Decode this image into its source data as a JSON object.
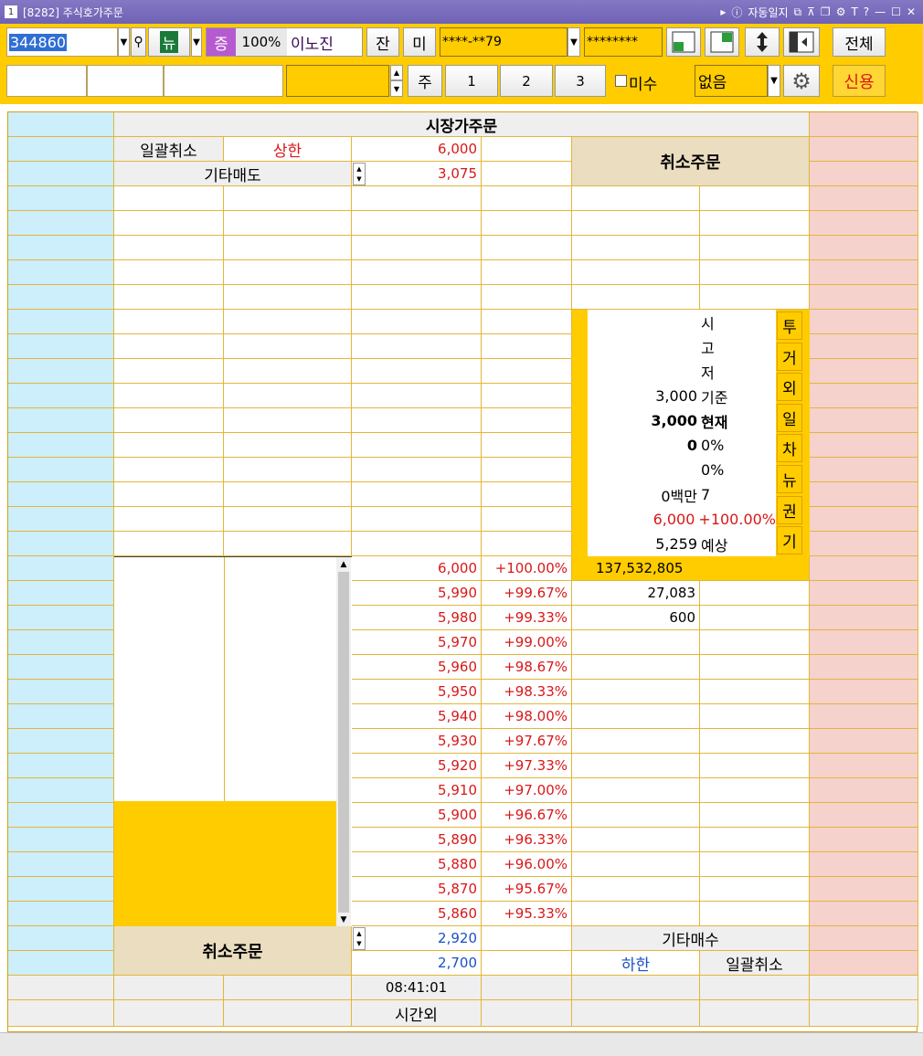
{
  "window": {
    "number": "1",
    "title": "[8282] 주식호가주문",
    "auto_log": "자동일지"
  },
  "toolbar": {
    "stock_code": "344860",
    "news_label": "뉴",
    "margin_badge": "증",
    "margin_rate": "100%",
    "stock_name": "이노진",
    "balance_label": "잔",
    "unfilled_label": "미",
    "account": "****-**79",
    "password": "********",
    "all_label": "전체",
    "qty_unit": "주",
    "qty_presets": [
      "1",
      "2",
      "3"
    ],
    "misu_label": "미수",
    "credit_select": "없음",
    "credit_label": "신용"
  },
  "orderbook": {
    "header_title": "시장가주문",
    "bulk_cancel_top": "일괄취소",
    "upper_limit_label": "상한",
    "upper_limit_price": "6,000",
    "other_sell_label": "기타매도",
    "other_sell_price": "3,075",
    "cancel_order_top": "취소주문",
    "info_labels": [
      "시",
      "고",
      "저",
      "기준",
      "현재"
    ],
    "base_price": "3,000",
    "current_price": "3,000",
    "change": "0",
    "change_pct": "0%",
    "change_pct2": "0%",
    "volume_amount": "0백만",
    "volume_count": "7",
    "expected_high": "6,000",
    "expected_high_pct": "+100.00%",
    "expected_price": "5,259",
    "expected_label": "예상",
    "side_buttons": [
      "투",
      "거",
      "외",
      "일",
      "차",
      "뉴",
      "권",
      "기"
    ],
    "bid_rows": [
      {
        "price": "6,000",
        "pct": "+100.00%",
        "qty": "137,532,805"
      },
      {
        "price": "5,990",
        "pct": "+99.67%",
        "qty": "27,083"
      },
      {
        "price": "5,980",
        "pct": "+99.33%",
        "qty": "600"
      },
      {
        "price": "5,970",
        "pct": "+99.00%",
        "qty": ""
      },
      {
        "price": "5,960",
        "pct": "+98.67%",
        "qty": ""
      },
      {
        "price": "5,950",
        "pct": "+98.33%",
        "qty": ""
      },
      {
        "price": "5,940",
        "pct": "+98.00%",
        "qty": ""
      },
      {
        "price": "5,930",
        "pct": "+97.67%",
        "qty": ""
      },
      {
        "price": "5,920",
        "pct": "+97.33%",
        "qty": ""
      },
      {
        "price": "5,910",
        "pct": "+97.00%",
        "qty": ""
      },
      {
        "price": "5,900",
        "pct": "+96.67%",
        "qty": ""
      },
      {
        "price": "5,890",
        "pct": "+96.33%",
        "qty": ""
      },
      {
        "price": "5,880",
        "pct": "+96.00%",
        "qty": ""
      },
      {
        "price": "5,870",
        "pct": "+95.67%",
        "qty": ""
      },
      {
        "price": "5,860",
        "pct": "+95.33%",
        "qty": ""
      }
    ],
    "cancel_order_bottom": "취소주문",
    "other_buy_price": "2,920",
    "other_buy_label": "기타매수",
    "lower_limit_price": "2,700",
    "lower_limit_label": "하한",
    "bulk_cancel_bottom": "일괄취소",
    "time": "08:41:01",
    "after_hours_label": "시간외"
  },
  "colors": {
    "accent": "#ffcc00",
    "ask_side": "#cdeefb",
    "bid_side": "#f5d2cc",
    "up": "#d81818",
    "down": "#1a4fc8"
  }
}
